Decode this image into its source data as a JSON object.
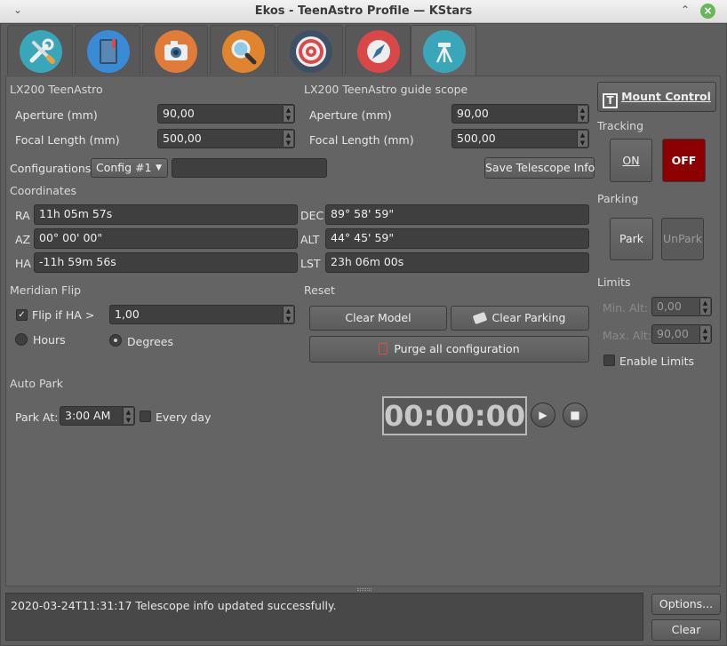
{
  "window": {
    "title": "Ekos - TeenAstro Profile — KStars",
    "menu_icon": "chevron-down-icon",
    "minimize_icon": "chevron-up-icon",
    "close_icon": "close-icon"
  },
  "tabs": [
    {
      "name": "setup",
      "icon": "wrench-screwdriver-icon",
      "color": "#3aa6b9"
    },
    {
      "name": "scheduler",
      "icon": "notebook-icon",
      "color": "#3b8ad6"
    },
    {
      "name": "capture",
      "icon": "camera-icon",
      "color": "#e07b3a"
    },
    {
      "name": "focus",
      "icon": "magnifier-icon",
      "color": "#e0852e"
    },
    {
      "name": "align",
      "icon": "target-icon",
      "color": "#d94a4a"
    },
    {
      "name": "guide",
      "icon": "compass-icon",
      "color": "#d94848"
    },
    {
      "name": "mount",
      "icon": "tripod-icon",
      "color": "#3aa6b9",
      "active": true
    }
  ],
  "telescope": {
    "primary_title": "LX200 TeenAstro",
    "guide_title": "LX200 TeenAstro guide scope",
    "aperture_label": "Aperture (mm)",
    "focal_label": "Focal Length (mm)",
    "primary_aperture": "90,00",
    "primary_focal": "500,00",
    "guide_aperture": "90,00",
    "guide_focal": "500,00",
    "config_label": "Configurations",
    "config_value": "Config #1",
    "config_name": "",
    "save_button": "Save Telescope Info"
  },
  "coordinates": {
    "title": "Coordinates",
    "ra_label": "RA",
    "ra": "11h 05m 57s",
    "az_label": "AZ",
    "az": " 00° 00' 00\"",
    "ha_label": "HA",
    "ha": "-11h 59m 56s",
    "dec_label": "DEC",
    "dec": " 89° 58' 59\"",
    "alt_label": "ALT",
    "alt": " 44° 45' 59\"",
    "lst_label": "LST",
    "lst": "23h 06m 00s"
  },
  "meridian": {
    "title": "Meridian Flip",
    "flip_label": "Flip if HA >",
    "flip_checked": true,
    "flip_value": "1,00",
    "hours_label": "Hours",
    "degrees_label": "Degrees"
  },
  "reset": {
    "title": "Reset",
    "clear_model": "Clear  Model",
    "clear_parking": "Clear Parking",
    "purge": "Purge all configuration"
  },
  "autopark": {
    "title": "Auto Park",
    "park_at_label": "Park At:",
    "time": "3:00 AM",
    "every_day": "Every day",
    "timer": "00:00:00"
  },
  "mount_control": {
    "button": "Mount Control",
    "tracking_title": "Tracking",
    "on": "ON",
    "off": "OFF",
    "parking_title": "Parking",
    "park": "Park",
    "unpark": "UnPark",
    "limits_title": "Limits",
    "min_alt_label": "Min. Alt:",
    "min_alt": "0,00",
    "max_alt_label": "Max. Alt:",
    "max_alt": "90,00",
    "enable_limits": "Enable Limits"
  },
  "log": {
    "message": "2020-03-24T11:31:17 Telescope info updated successfully.",
    "options_button": "Options...",
    "clear_button": "Clear"
  },
  "colors": {
    "off_red": "#8b0000",
    "timer_border": "#b8b8b8"
  }
}
